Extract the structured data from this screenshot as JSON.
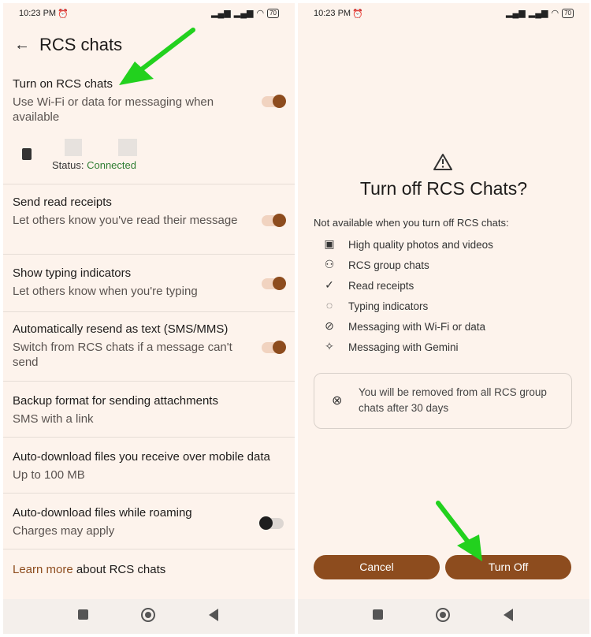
{
  "status": {
    "time": "10:23 PM",
    "battery": "70"
  },
  "left": {
    "title": "RCS chats",
    "items": [
      {
        "title": "Turn on RCS chats",
        "subtitle": "Use Wi-Fi or data for messaging when available",
        "toggle": "on"
      },
      {
        "title": "Send read receipts",
        "subtitle": "Let others know you've read their message",
        "toggle": "on"
      },
      {
        "title": "Show typing indicators",
        "subtitle": "Let others know when you're typing",
        "toggle": "on"
      },
      {
        "title": "Automatically resend as text (SMS/MMS)",
        "subtitle": "Switch from RCS chats if a message can't send",
        "toggle": "on"
      },
      {
        "title": "Backup format for sending attachments",
        "subtitle": "SMS with a link"
      },
      {
        "title": "Auto-download files you receive over mobile data",
        "subtitle": "Up to 100 MB"
      },
      {
        "title": "Auto-download files while roaming",
        "subtitle": "Charges may apply",
        "toggle": "off"
      }
    ],
    "sim_status_label": "Status:",
    "sim_status_value": "Connected",
    "learn_more_link": "Learn more",
    "learn_more_rest": " about RCS chats"
  },
  "dialog": {
    "title": "Turn off RCS Chats?",
    "subtitle": "Not available when you turn off RCS chats:",
    "features": [
      {
        "icon": "photo-icon",
        "label": "High quality photos and videos"
      },
      {
        "icon": "group-icon",
        "label": "RCS group chats"
      },
      {
        "icon": "check-circle-icon",
        "label": "Read receipts"
      },
      {
        "icon": "typing-icon",
        "label": "Typing indicators"
      },
      {
        "icon": "wifi-off-icon",
        "label": "Messaging with Wi-Fi or data"
      },
      {
        "icon": "sparkle-icon",
        "label": "Messaging with Gemini"
      }
    ],
    "notice": "You will be removed from all RCS group chats after 30 days",
    "cancel": "Cancel",
    "turn_off": "Turn Off"
  },
  "colors": {
    "accent": "#8d4c1e",
    "arrow": "#22d11e",
    "connected": "#2e7d32"
  }
}
